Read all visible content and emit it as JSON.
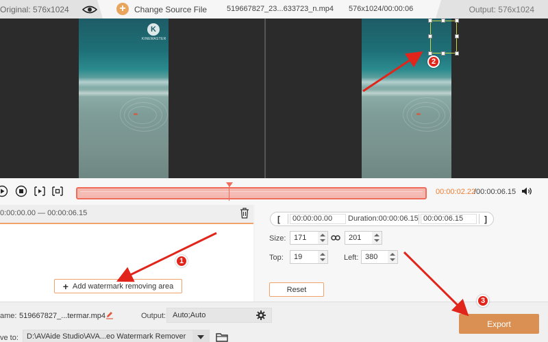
{
  "topbar": {
    "original_label": "Original: 576x1024",
    "change_source_label": "Change Source File",
    "file_name": "519667827_23...633723_n.mp4",
    "file_resolution_duration": "576x1024/00:00:06",
    "output_label": "Output: 576x1024"
  },
  "preview": {
    "watermark_text": "KINEMASTER",
    "watermark_logo": "K"
  },
  "timeline": {
    "current_time": "00:00:02.22",
    "total_time": "/00:00:06.15"
  },
  "segment": {
    "time_range": "0:00:00.00 — 00:00:06.15",
    "add_area_label": "Add watermark removing area"
  },
  "settings": {
    "start_time": "00:00:00.00",
    "duration": "Duration:00:00:06.15",
    "end_time": "00:00:06.15",
    "size_label": "Size:",
    "width": "171",
    "height": "201",
    "top_label": "Top:",
    "top": "19",
    "left_label": "Left:",
    "left": "380",
    "reset_label": "Reset"
  },
  "bottom": {
    "name_label": "ame:",
    "name_value": "519667827_...termar.mp4",
    "output_label": "Output:",
    "output_value": "Auto;Auto",
    "save_label": "ve to:",
    "save_path": "D:\\AVAide Studio\\AVA...eo Watermark Remover",
    "export_label": "Export"
  },
  "annotations": {
    "badge_1": "1",
    "badge_2": "2",
    "badge_3": "3"
  },
  "colors": {
    "accent_orange": "#d99052",
    "timeline_red": "#ef6b5a",
    "badge_red": "#e1251b",
    "selection_green": "#c8d84a"
  }
}
